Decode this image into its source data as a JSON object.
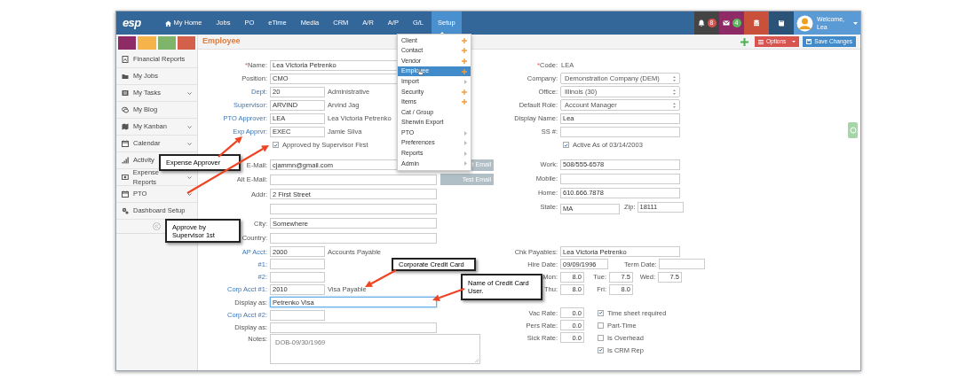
{
  "app": {
    "logo": "esp"
  },
  "nav": [
    {
      "label": "My Home",
      "kind": "home",
      "selected": false
    },
    {
      "label": "Jobs",
      "selected": false
    },
    {
      "label": "PO",
      "selected": false
    },
    {
      "label": "eTime",
      "selected": false
    },
    {
      "label": "Media",
      "selected": false
    },
    {
      "label": "CRM",
      "selected": false
    },
    {
      "label": "A/R",
      "selected": false
    },
    {
      "label": "A/P",
      "selected": false
    },
    {
      "label": "G/L",
      "selected": false
    },
    {
      "label": "Setup",
      "selected": true
    }
  ],
  "header_icons": [
    {
      "kind": "bell",
      "badge": "8",
      "color": "#d9534f"
    },
    {
      "kind": "mail",
      "badge": "4",
      "color": "#5cb85c"
    },
    {
      "kind": "database"
    },
    {
      "kind": "book"
    }
  ],
  "user": {
    "greeting": "Welcome,",
    "name": "Lea"
  },
  "swatches": [
    {
      "color": "#8e2a66"
    },
    {
      "color": "#f6b34a"
    },
    {
      "color": "#7fb56b"
    },
    {
      "color": "#d2604a"
    }
  ],
  "sidebar": {
    "items": [
      {
        "label": "Financial Reports",
        "kind": "report",
        "expandable": false
      },
      {
        "label": "My Jobs",
        "kind": "folder",
        "expandable": false
      },
      {
        "label": "My Tasks",
        "kind": "tasks",
        "expandable": true
      },
      {
        "label": "My Blog",
        "kind": "chat",
        "expandable": false
      },
      {
        "label": "My Kanban",
        "kind": "map",
        "expandable": true
      },
      {
        "label": "Calendar",
        "kind": "calendar",
        "expandable": true
      },
      {
        "label": "Activity",
        "kind": "bars",
        "expandable": false
      },
      {
        "label": "Expense Reports",
        "kind": "money",
        "expandable": true
      },
      {
        "label": "PTO",
        "kind": "calendar",
        "expandable": true
      },
      {
        "label": "Dashboard Setup",
        "kind": "gears",
        "expandable": false
      }
    ]
  },
  "page": {
    "title": "Employee",
    "options_label": "Options",
    "save_label": "Save Changes"
  },
  "setup_menu": [
    {
      "label": "Client",
      "kind": "add",
      "selected": false
    },
    {
      "label": "Contact",
      "kind": "add",
      "selected": false
    },
    {
      "label": "Vendor",
      "kind": "add",
      "selected": false
    },
    {
      "label": "Employee",
      "kind": "add",
      "selected": true
    },
    {
      "label": "Import",
      "kind": "submenu",
      "selected": false
    },
    {
      "label": "Security",
      "kind": "add",
      "selected": false
    },
    {
      "label": "Items",
      "kind": "add",
      "selected": false
    },
    {
      "label": "Cat / Group",
      "kind": "plain",
      "selected": false
    },
    {
      "label": "Sherwin Export",
      "kind": "plain",
      "selected": false
    },
    {
      "label": "PTO",
      "kind": "submenu",
      "selected": false
    },
    {
      "label": "Preferences",
      "kind": "submenu",
      "selected": false
    },
    {
      "label": "Reports",
      "kind": "submenu",
      "selected": false
    },
    {
      "label": "Admin",
      "kind": "submenu",
      "selected": false
    }
  ],
  "left_sections": [
    [
      {
        "label": "Name:",
        "required_mark": "*",
        "kind": "wide",
        "value": "Lea Victoria Petrenko"
      },
      {
        "label": "Position:",
        "kind": "wide",
        "value": "CMO"
      },
      {
        "label": "Dept:",
        "link": true,
        "kind": "short",
        "value": "20",
        "side": "Administrative"
      },
      {
        "label": "Supervisor:",
        "link": true,
        "kind": "short",
        "value": "ARVIND",
        "side": "Arvind Jag"
      },
      {
        "label": "PTO Approver:",
        "link": true,
        "kind": "short",
        "value": "LEA",
        "side": "Lea Victoria Petrenko"
      },
      {
        "label": "Exp Apprvr:",
        "link": true,
        "kind": "short",
        "value": "EXEC",
        "side": "Jamie Silva"
      },
      {
        "kind": "check",
        "text": "Approved by Supervisor First",
        "checked": true
      }
    ],
    [
      {
        "label": "E-Mail:",
        "kind": "wide",
        "value": "cjammn@gmail.com",
        "button": "t Email"
      },
      {
        "label": "Alt E-Mail:",
        "kind": "wide",
        "button": "Test Email"
      },
      {
        "label": "Addr:",
        "kind": "wide",
        "value": "2 First Street"
      },
      {
        "kind": "wide"
      },
      {
        "label": "City:",
        "kind": "wide",
        "value": "Somewhere"
      },
      {
        "label": "Country:",
        "kind": "wide"
      }
    ],
    [
      {
        "label": "AP Acct:",
        "link": true,
        "kind": "short",
        "value": "2000",
        "side": "Accounts Payable"
      },
      {
        "label": "#1:",
        "link": true,
        "kind": "short"
      },
      {
        "label": "#2:",
        "link": true,
        "kind": "short"
      },
      {
        "label": "Corp Acct #1:",
        "link": true,
        "kind": "short",
        "value": "2010",
        "side": "Visa Payable"
      },
      {
        "label": "Display as:",
        "kind": "wide",
        "value": "Petrenko Visa",
        "focused": true
      },
      {
        "label": "Corp Acct #2:",
        "link": true,
        "kind": "short"
      },
      {
        "label": "Display as:",
        "kind": "wide"
      },
      {
        "label": "Notes:",
        "kind": "textarea",
        "value": "DOB-09/30/1969"
      }
    ]
  ],
  "right_sections": [
    [
      {
        "label": "Code:",
        "required_mark": "*",
        "kind": "static",
        "value": "LEA"
      },
      {
        "label": "Company:",
        "kind": "select",
        "value": "Demonstration Company (DEM)"
      },
      {
        "label": "Office:",
        "kind": "select",
        "value": "Illinois (30)"
      },
      {
        "label": "Default Role:",
        "kind": "select",
        "value": "Account Manager"
      },
      {
        "label": "Display Name:",
        "kind": "wide",
        "value": "Lea"
      },
      {
        "label": "SS #:",
        "kind": "wide"
      },
      {
        "kind": "check",
        "text": "Active As of 03/14/2003",
        "checked": true
      }
    ],
    [
      {
        "label": "Work:",
        "kind": "wide",
        "value": "508/555-6578"
      },
      {
        "label": "Mobile:",
        "kind": "wide"
      },
      {
        "label": "Home:",
        "kind": "wide",
        "value": "610.666.7878"
      },
      {
        "label": "State:",
        "kind": "pair",
        "value": "MA",
        "label2": "Zip:",
        "value2": "18111"
      }
    ],
    [
      {
        "label": "Chk Payables:",
        "kind": "wide",
        "value": "Lea Victoria Petrenko"
      },
      {
        "label": "Hire Date:",
        "kind": "pair",
        "value": "09/09/1996",
        "label2": "Term Date:"
      },
      {
        "kind": "hours",
        "cells": [
          {
            "label": "Mon:",
            "value": "8.0"
          },
          {
            "label": "Tue:",
            "value": "7.5"
          },
          {
            "label": "Wed:",
            "value": "7.5"
          }
        ]
      },
      {
        "label": "Thu:",
        "kind": "hours",
        "value": "8.0",
        "cells": [
          {
            "label": "Fri:",
            "value": "8.0"
          }
        ]
      }
    ],
    [
      {
        "label": "Vac Rate:",
        "kind": "rate",
        "value": "0.0",
        "check": {
          "text": "Time sheet required",
          "checked": true
        }
      },
      {
        "label": "Pers Rate:",
        "kind": "rate",
        "value": "0.0",
        "check": {
          "text": "Part-Time",
          "checked": false
        }
      },
      {
        "label": "Sick Rate:",
        "kind": "rate",
        "value": "0.0",
        "check": {
          "text": "Is Overhead",
          "checked": false
        }
      },
      {
        "kind": "subcheck",
        "text": "Is CRM Rep",
        "checked": true
      }
    ]
  ],
  "callouts": [
    {
      "text": "Expense Approver"
    },
    {
      "text": "Approve by Supervisor 1st"
    },
    {
      "text": "Corporate Credit Card"
    },
    {
      "text": "Name of Credit Card User."
    }
  ]
}
